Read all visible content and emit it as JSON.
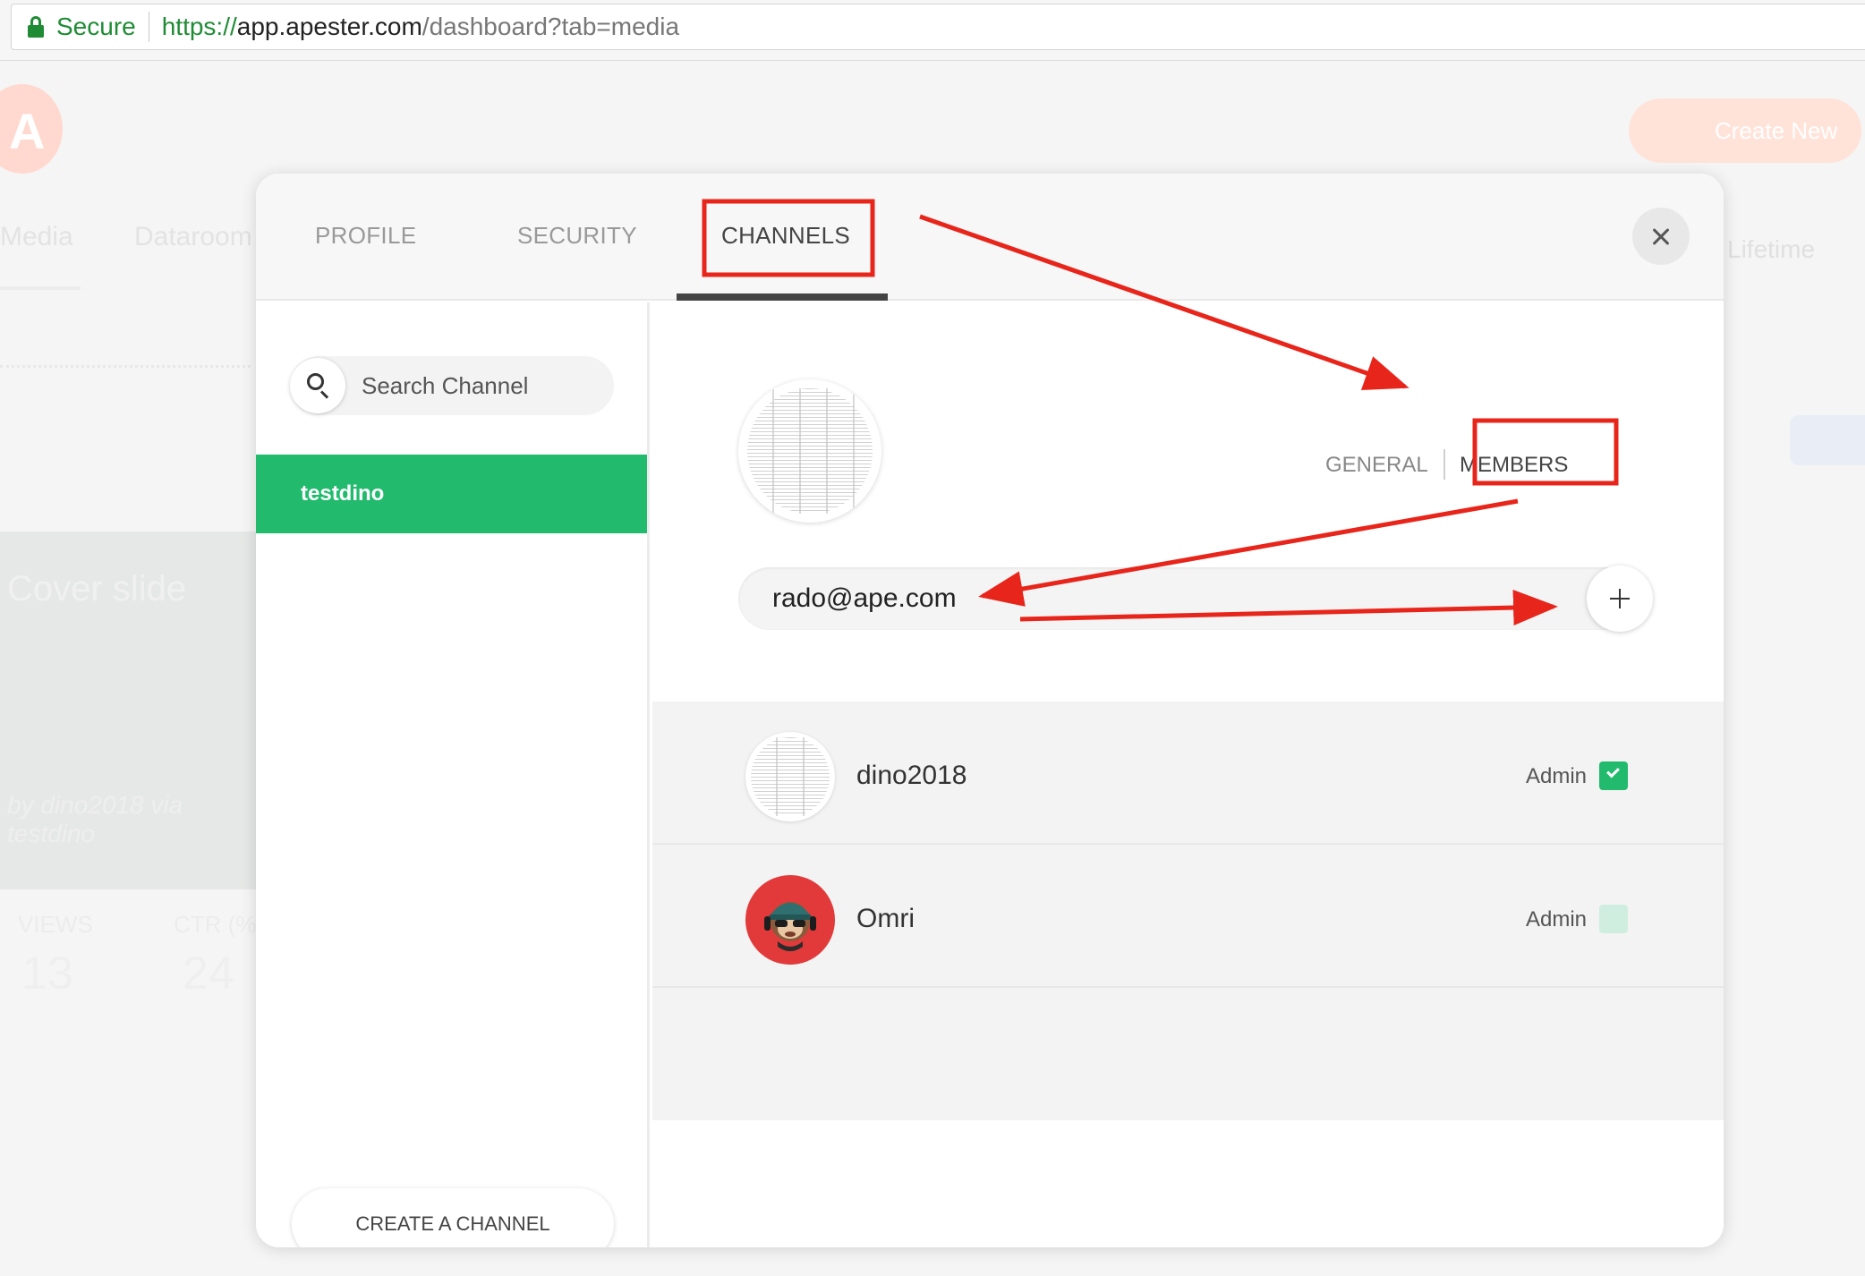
{
  "browser": {
    "secure_label": "Secure",
    "url_scheme": "https://",
    "url_host": "app.apester.com",
    "url_path": "/dashboard?tab=media"
  },
  "background": {
    "logo_letter": "A",
    "create_label": "Create New",
    "tabs": [
      "Media",
      "Dataroom"
    ],
    "lifetime_label": "Lifetime",
    "card_title": "Cover slide",
    "card_byline": "by dino2018 via testdino",
    "stats": [
      {
        "label": "VIEWS",
        "value": "13"
      },
      {
        "label": "CTR (%)",
        "value": "24"
      }
    ]
  },
  "modal": {
    "tabs": [
      {
        "label": "PROFILE",
        "active": false
      },
      {
        "label": "SECURITY",
        "active": false
      },
      {
        "label": "CHANNELS",
        "active": true
      }
    ],
    "close_icon": "close-icon",
    "sidebar": {
      "search_placeholder": "Search Channel",
      "channels": [
        {
          "label": "testdino",
          "selected": true
        }
      ],
      "create_label": "CREATE A CHANNEL"
    },
    "content": {
      "subtabs": [
        {
          "label": "GENERAL",
          "active": false
        },
        {
          "label": "MEMBERS",
          "active": true
        }
      ],
      "member_input_value": "rado@ape.com",
      "add_icon": "plus-icon",
      "members": [
        {
          "name": "dino2018",
          "role": "Admin",
          "is_admin": true
        },
        {
          "name": "Omri",
          "role": "Admin",
          "is_admin": false
        }
      ]
    }
  },
  "colors": {
    "accent_green": "#22bb6e",
    "annotation_red": "#e8251b",
    "secure_green": "#1f8c35"
  }
}
